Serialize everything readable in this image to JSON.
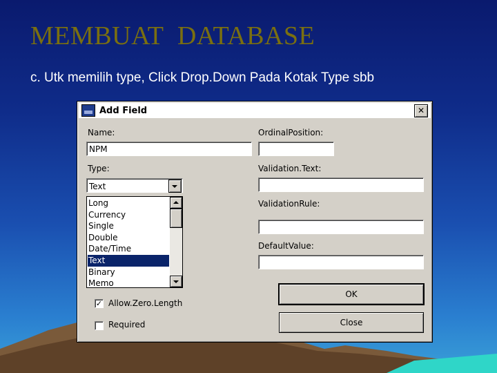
{
  "slide": {
    "title": "MEMBUAT  DATABASE",
    "subtitle": "c. Utk memilih type, Click Drop.Down Pada Kotak Type sbb"
  },
  "dialog": {
    "title": "Add Field",
    "close_glyph": "✕",
    "labels": {
      "name": "Name:",
      "type": "Type:",
      "ordinal_position": "OrdinalPosition:",
      "validation_text": "Validation.Text:",
      "validation_rule": "ValidationRule:",
      "default_value": "DefaultValue:"
    },
    "fields": {
      "name_value": "NPM",
      "type_value": "Text"
    },
    "type_options": [
      "Long",
      "Currency",
      "Single",
      "Double",
      "Date/Time",
      "Text",
      "Binary",
      "Memo"
    ],
    "selected_type_index": 5,
    "checkboxes": {
      "allow_zero_length": {
        "label": "Allow.Zero.Length",
        "checked": true
      },
      "required": {
        "label": "Required",
        "checked": false
      }
    },
    "buttons": {
      "ok": "OK",
      "close": "Close"
    },
    "check_glyph": "✓"
  }
}
